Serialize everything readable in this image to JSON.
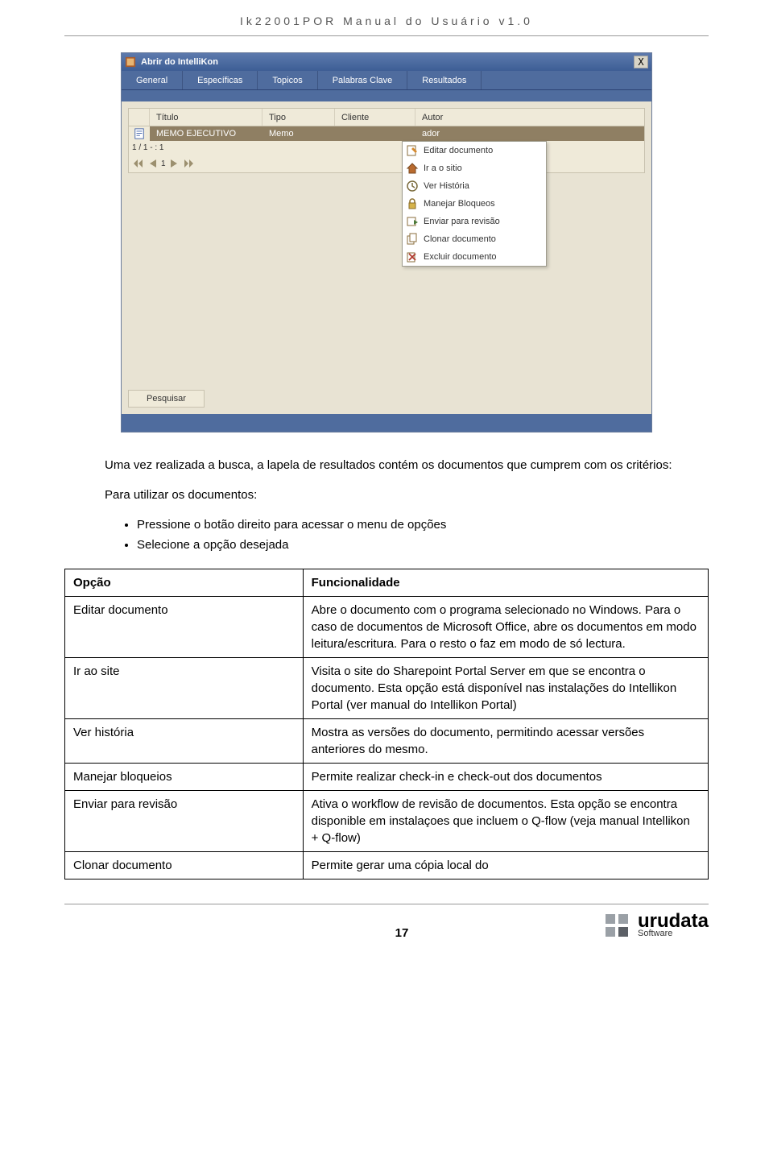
{
  "header": "Ik22001POR Manual do Usuário v1.0",
  "window": {
    "title": "Abrir do IntelliKon",
    "tabs": [
      "General",
      "Específicas",
      "Topicos",
      "Palabras Clave",
      "Resultados"
    ],
    "grid": {
      "headers": {
        "titulo": "Título",
        "tipo": "Tipo",
        "cliente": "Cliente",
        "autor": "Autor"
      },
      "row": {
        "titulo": "MEMO EJECUTIVO",
        "tipo": "Memo",
        "cliente": "",
        "autor": "ador"
      }
    },
    "pager_text": "1 / 1 - : 1",
    "pager_current": "1",
    "context_menu": [
      {
        "name": "ctx-editar",
        "icon": "edit-icon",
        "label": "Editar documento"
      },
      {
        "name": "ctx-ir-sitio",
        "icon": "home-icon",
        "label": "Ir a o sitio"
      },
      {
        "name": "ctx-ver-historia",
        "icon": "history-icon",
        "label": "Ver História"
      },
      {
        "name": "ctx-manejar-bloqueos",
        "icon": "lock-icon",
        "label": "Manejar Bloqueos"
      },
      {
        "name": "ctx-enviar-revisao",
        "icon": "send-icon",
        "label": "Enviar para revisão"
      },
      {
        "name": "ctx-clonar",
        "icon": "clone-icon",
        "label": "Clonar documento"
      },
      {
        "name": "ctx-excluir",
        "icon": "delete-icon",
        "label": "Excluir documento"
      }
    ],
    "search_label": "Pesquisar"
  },
  "body": {
    "intro": "Uma vez realizada a busca, a lapela de resultados contém os documentos que cumprem com os critérios:",
    "sub": "Para utilizar os documentos:",
    "bullets": [
      "Pressione o botão direito para acessar o menu de opções",
      "Selecione a opção desejada"
    ]
  },
  "table": {
    "head": {
      "c1": "Opção",
      "c2": "Funcionalidade"
    },
    "rows": [
      {
        "c1": "Editar documento",
        "c2": "Abre o documento com o programa selecionado no Windows. Para o caso de documentos de Microsoft Office, abre os documentos em modo leitura/escritura. Para o resto o faz em modo de só lectura."
      },
      {
        "c1": "Ir ao site",
        "c2": "Visita o site do Sharepoint Portal Server em que se encontra o documento. Esta opção está disponível nas instalações do Intellikon Portal (ver manual do Intellikon Portal)"
      },
      {
        "c1": "Ver história",
        "c2": "Mostra as versões do documento, permitindo acessar versões anteriores do mesmo."
      },
      {
        "c1": "Manejar bloqueios",
        "c2": "Permite realizar check-in e check-out dos documentos"
      },
      {
        "c1": "Enviar para revisão",
        "c2": "Ativa o workflow de revisão de documentos. Esta opção se encontra disponible em instalaçoes que incluem o Q-flow (veja manual Intellikon + Q-flow)"
      },
      {
        "c1": "Clonar documento",
        "c2": "Permite gerar uma cópia local do"
      }
    ]
  },
  "footer": {
    "page": "17",
    "brand": "urudata",
    "brand_sub": "Software"
  }
}
